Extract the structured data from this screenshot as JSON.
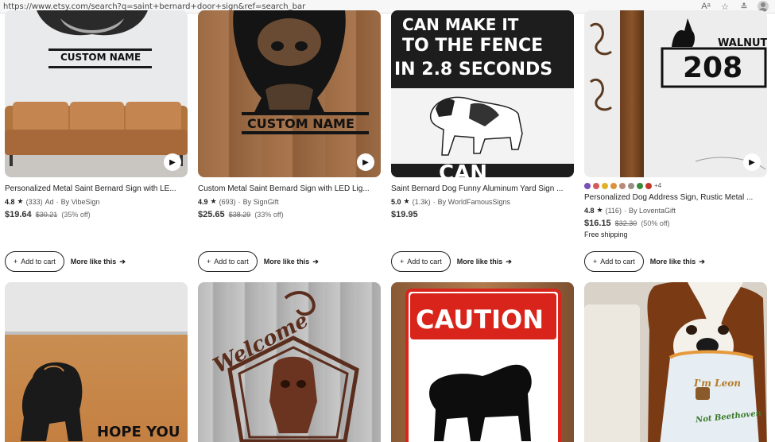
{
  "browser": {
    "url": "https://www.etsy.com/search?q=saint+bernard+door+sign&ref=search_bar",
    "icons": [
      "read-aloud-icon",
      "favorite-star-icon",
      "favorites-list-icon",
      "profile-avatar"
    ]
  },
  "listings": [
    {
      "title": "Personalized Metal Saint Bernard Sign with LE...",
      "rating": "4.8",
      "reviews": "(333)",
      "ad": "Ad",
      "shop": "By VibeSign",
      "price": "$19.64",
      "orig_price": "$30.21",
      "discount": "(35% off)",
      "has_video": true,
      "image_text": "CUSTOM NAME"
    },
    {
      "title": "Custom Metal Saint Bernard Sign with LED Lig...",
      "rating": "4.9",
      "reviews": "(693)",
      "shop": "By SignGift",
      "price": "$25.65",
      "orig_price": "$38.29",
      "discount": "(33% off)",
      "has_video": true,
      "image_text": "CUSTOM NAME"
    },
    {
      "title": "Saint Bernard Dog Funny Aluminum Yard Sign ...",
      "rating": "5.0",
      "reviews": "(1.3k)",
      "shop": "By WorldFamousSigns",
      "price": "$19.95",
      "image_text_1": "CAN MAKE IT",
      "image_text_2": "TO THE FENCE",
      "image_text_3": "IN 2.8 SECONDS",
      "image_text_4": "CAN"
    },
    {
      "title": "Personalized Dog Address Sign, Rustic Metal ...",
      "rating": "4.8",
      "reviews": "(116)",
      "shop": "By LoventaGift",
      "price": "$16.15",
      "orig_price": "$32.30",
      "discount": "(50% off)",
      "shipping": "Free shipping",
      "swatch_more": "+4",
      "swatch_colors": [
        "#7b4fb8",
        "#d65a5a",
        "#e0b22a",
        "#d9923a",
        "#b9897a",
        "#9a8f86",
        "#3a8a3a",
        "#c0392b"
      ],
      "has_video": true,
      "image_text_1": "WALNUT",
      "image_text_2": "208"
    }
  ],
  "row2": [
    {
      "image_text": "HOPE YOU LIKI"
    },
    {
      "image_text": "Welcome"
    },
    {
      "image_text": "CAUTION"
    },
    {
      "image_text_1": "I'm Leon",
      "image_text_2": "Not Beethoven"
    }
  ],
  "actions": {
    "add_to_cart": "Add to cart",
    "more_like_this": "More like this"
  }
}
